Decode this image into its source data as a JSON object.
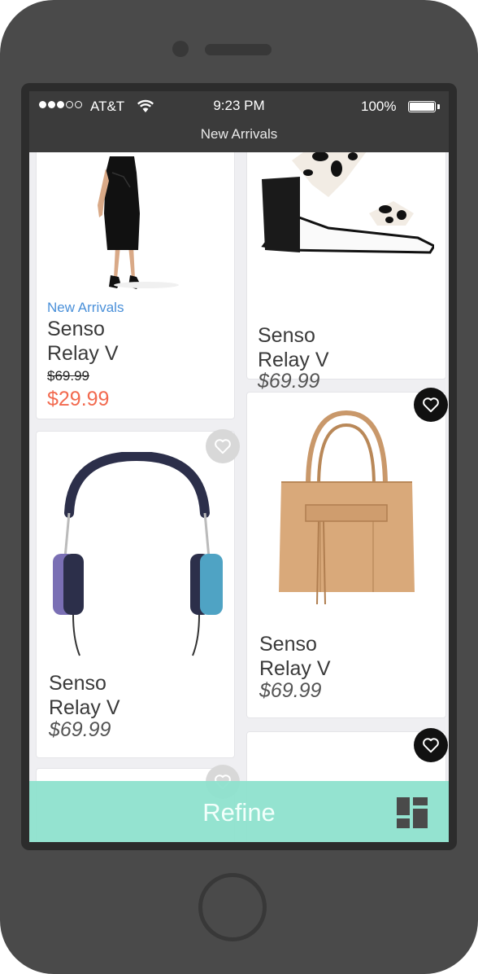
{
  "status_bar": {
    "carrier": "AT&T",
    "time": "9:23 PM",
    "battery": "100%",
    "signal_bars": 3
  },
  "nav": {
    "title": "New Arrivals"
  },
  "products": [
    {
      "tag": "New Arrivals",
      "name_line1": "Senso",
      "name_line2": "Relay V",
      "old_price": "$69.99",
      "price": "$29.99",
      "image": "dress-figure"
    },
    {
      "name_line1": "Senso",
      "name_line2": "Relay V",
      "price": "$69.99",
      "image": "leopard-block-heel-sandal"
    },
    {
      "name_line1": "Senso",
      "name_line2": "Relay V",
      "price": "$69.99",
      "image": "headphones",
      "favorited": false
    },
    {
      "name_line1": "Senso",
      "name_line2": "Relay V",
      "price": "$69.99",
      "image": "tan-leather-tote",
      "favorited": true
    }
  ],
  "refine": {
    "label": "Refine",
    "icon": "layout-grid-icon"
  },
  "colors": {
    "frame": "#4a4a4a",
    "header": "#3b3b3b",
    "refine_bar": "#8ee2ce",
    "sale": "#f26a4f",
    "tag": "#4a90d9"
  }
}
